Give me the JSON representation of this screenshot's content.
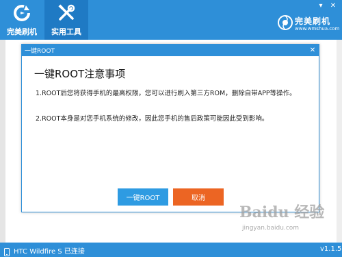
{
  "header": {
    "tabs": [
      {
        "label": "完美刷机",
        "icon": "refresh-icon"
      },
      {
        "label": "实用工具",
        "icon": "tools-icon"
      }
    ],
    "brand": {
      "name": "完美刷机",
      "url": "www.wmshua.com"
    },
    "window_controls": {
      "minimize": "▾",
      "close": "✕"
    }
  },
  "dialog": {
    "title": "一键ROOT",
    "close": "✕",
    "heading": "一键ROOT注意事项",
    "paragraphs": [
      "1.ROOT后您将获得手机的最高权限，您可以进行刷入第三方ROM，删除自带APP等操作。",
      "2.ROOT本身是对您手机系统的修改，因此您手机的售后政策可能因此受到影响。"
    ],
    "buttons": {
      "root": "一键ROOT",
      "cancel": "取消"
    }
  },
  "watermark": {
    "text": "Baidu 经验",
    "url": "jingyan.baidu.com"
  },
  "statusbar": {
    "device": "HTC Wildfire S 已连接",
    "version": "v1.1.5"
  },
  "colors": {
    "primary": "#2e8fd8",
    "cancel": "#ec6523",
    "root_button": "#2e9be2"
  }
}
